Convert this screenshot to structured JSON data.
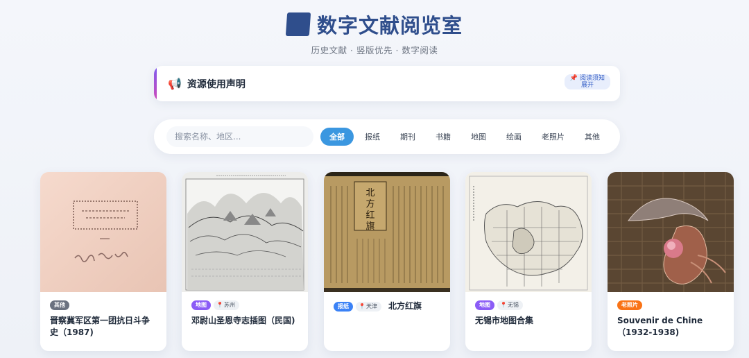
{
  "header": {
    "title": "数字文献阅览室",
    "subtitle": "历史文献 · 竖版优先 · 数字阅读",
    "brand_color": "#2f4e8c"
  },
  "notice": {
    "icon": "megaphone-icon",
    "title": "资源使用声明",
    "action_read": "阅读须知",
    "action_expand": "展开"
  },
  "filter": {
    "search_placeholder": "搜索名称、地区...",
    "categories": [
      "全部",
      "报纸",
      "期刊",
      "书籍",
      "地图",
      "绘画",
      "老照片",
      "其他"
    ],
    "active_category": "全部",
    "accent_color": "#3b97e0"
  },
  "cards": [
    {
      "category": "其他",
      "location": "",
      "title": "晋察冀军区第一团抗日斗争史（1987)"
    },
    {
      "category": "地图",
      "location": "苏州",
      "title": "邓尉山圣恩寺志插图（民国)"
    },
    {
      "category": "报纸",
      "location": "天津",
      "title": "北方红旗"
    },
    {
      "category": "地图",
      "location": "无锡",
      "title": "无锡市地图合集"
    },
    {
      "category": "老照片",
      "location": "",
      "title": "Souvenir de Chine（1932-1938)"
    }
  ]
}
